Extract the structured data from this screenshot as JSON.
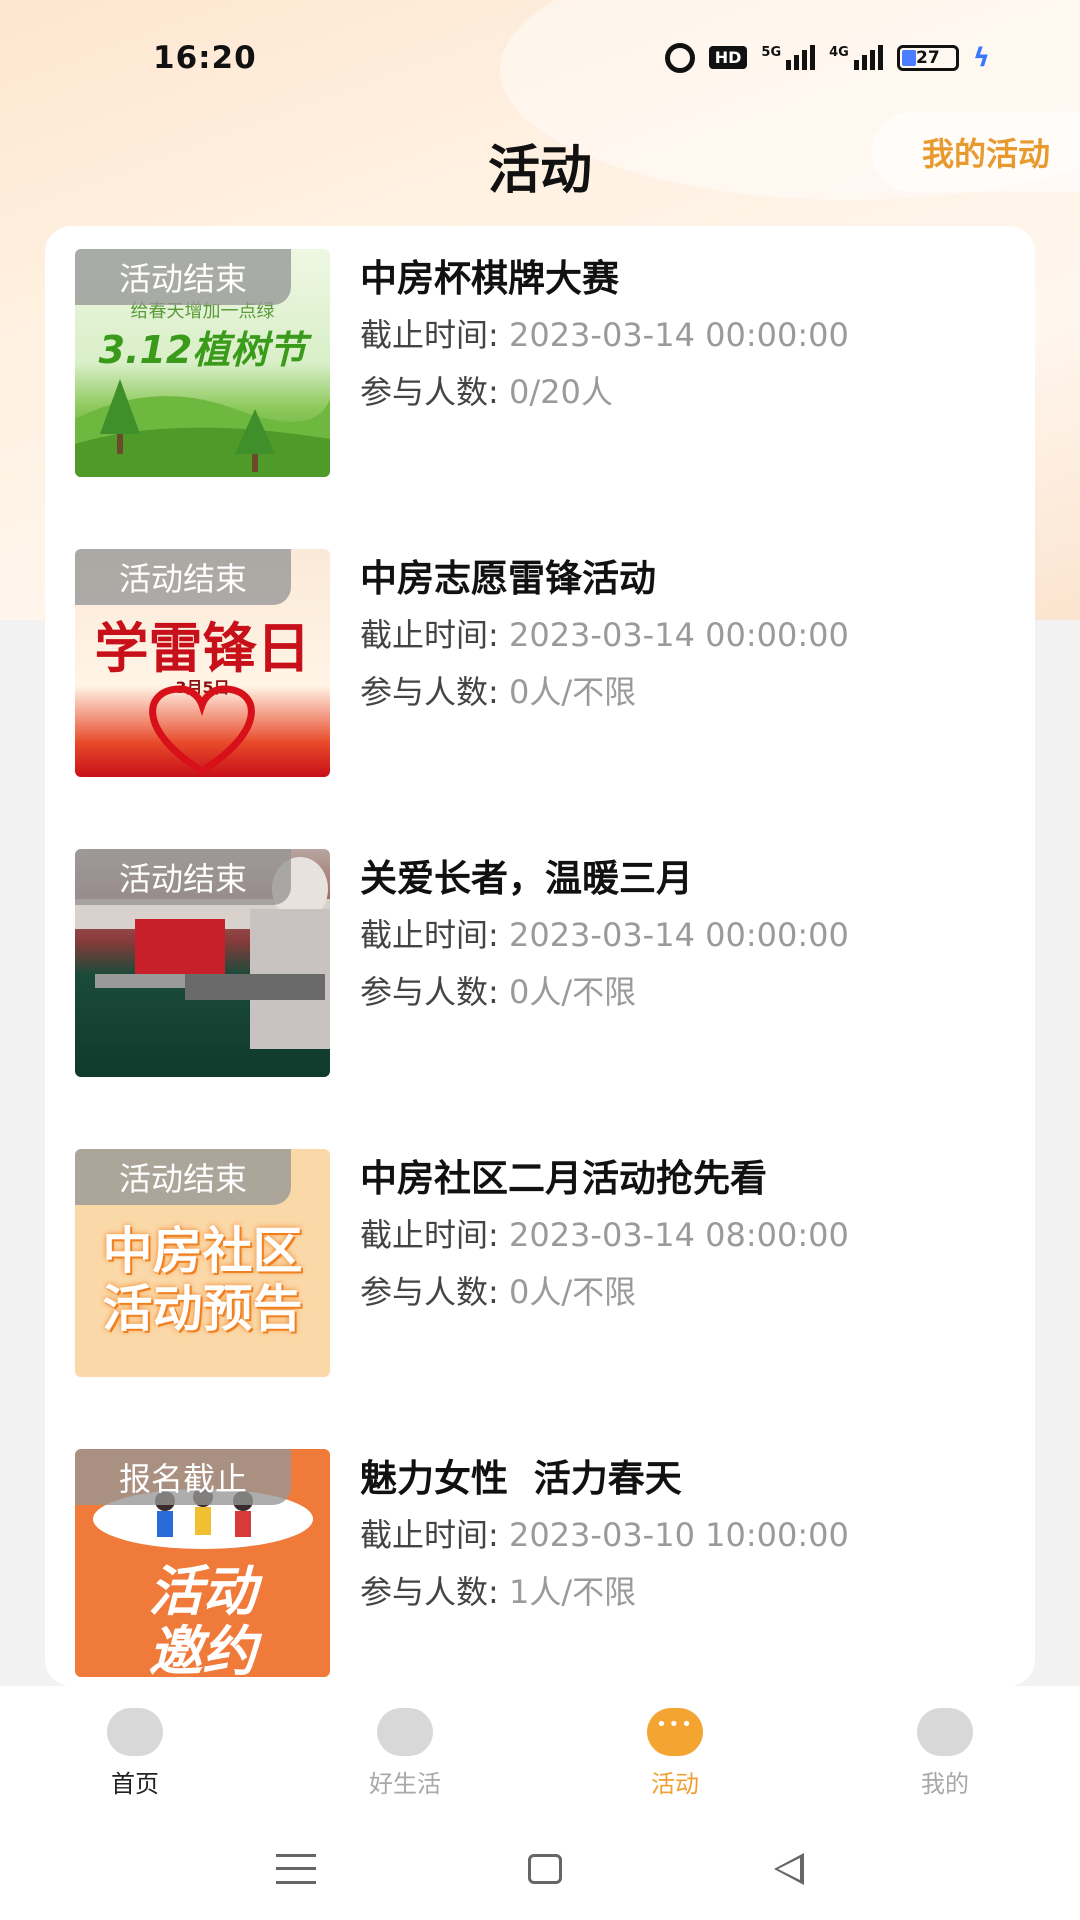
{
  "status_bar": {
    "time": "16:20",
    "hd": "HD",
    "net1": "5G",
    "net2": "4G",
    "battery": "27"
  },
  "header": {
    "title": "活动",
    "my_activity": "我的活动"
  },
  "activities": [
    {
      "status": "活动结束",
      "title": "中房杯棋牌大赛",
      "deadline_label": "截止时间:",
      "deadline": "2023-03-14 00:00:00",
      "people_label": "参与人数:",
      "people": "0/20人",
      "thumb_text": "3.12植树节",
      "thumb_sub": "给春天增加一点绿"
    },
    {
      "status": "活动结束",
      "title": "中房志愿雷锋活动",
      "deadline_label": "截止时间:",
      "deadline": "2023-03-14 00:00:00",
      "people_label": "参与人数:",
      "people": "0人/不限",
      "thumb_text": "学雷锋日",
      "thumb_sub": "3月5日"
    },
    {
      "status": "活动结束",
      "title": "关爱长者，温暖三月",
      "deadline_label": "截止时间:",
      "deadline": "2023-03-14 00:00:00",
      "people_label": "参与人数:",
      "people": "0人/不限"
    },
    {
      "status": "活动结束",
      "title": "中房社区二月活动抢先看",
      "deadline_label": "截止时间:",
      "deadline": "2023-03-14 08:00:00",
      "people_label": "参与人数:",
      "people": "0人/不限",
      "thumb_text": "中房社区",
      "thumb_sub": "活动预告"
    },
    {
      "status": "报名截止",
      "title": "魅力女性  活力春天",
      "deadline_label": "截止时间:",
      "deadline": "2023-03-10 10:00:00",
      "people_label": "参与人数:",
      "people": "1人/不限",
      "thumb_text": "活动",
      "thumb_sub": "邀约"
    }
  ],
  "tabbar": [
    {
      "label": "首页",
      "icon": "home-icon"
    },
    {
      "label": "好生活",
      "icon": "life-icon"
    },
    {
      "label": "活动",
      "icon": "activity-chat-icon",
      "active": true
    },
    {
      "label": "我的",
      "icon": "profile-icon"
    }
  ],
  "colors": {
    "accent": "#f0a030",
    "badge_bg": "#969696"
  }
}
